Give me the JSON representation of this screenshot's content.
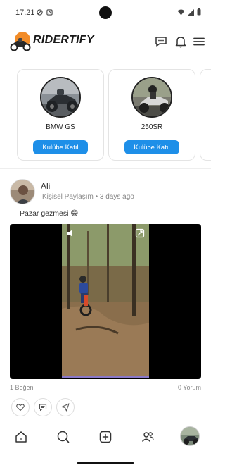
{
  "status_bar": {
    "time": "17:21"
  },
  "header": {
    "brand": "RIDERTIFY"
  },
  "clubs": [
    {
      "name": "BMW GS",
      "join_label": "Kulübe Katıl"
    },
    {
      "name": "250SR",
      "join_label": "Kulübe Katıl"
    }
  ],
  "post": {
    "author": "Ali",
    "category": "Kişisel Paylaşım",
    "separator": "•",
    "time_ago": "3 days ago",
    "text": "Pazar gezmesi 😄",
    "likes": "1 Beğeni",
    "comments": "0 Yorum"
  },
  "colors": {
    "accent": "#1e8fe8",
    "brand_orange": "#f28c28",
    "video_bar": "#8a78c8"
  },
  "icons": {
    "header": [
      "chat-icon",
      "bell-icon",
      "menu-icon"
    ],
    "post_actions": [
      "heart-icon",
      "comment-icon",
      "share-icon"
    ],
    "nav": [
      "home-icon",
      "search-icon",
      "add-icon",
      "people-icon",
      "profile-avatar"
    ]
  }
}
